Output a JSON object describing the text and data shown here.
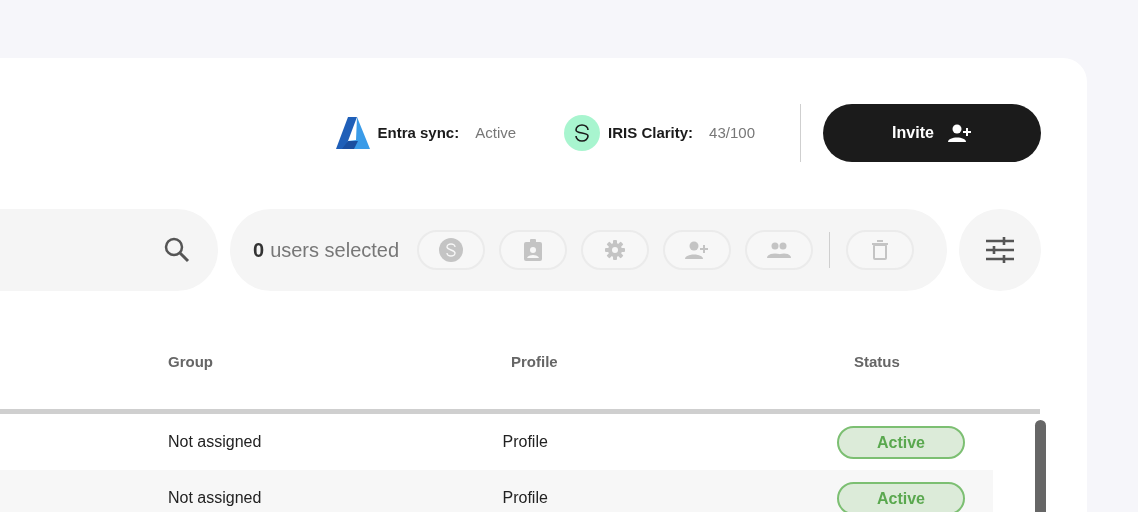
{
  "header": {
    "entra_sync": {
      "label": "Entra sync:",
      "value": "Active"
    },
    "iris_clarity": {
      "label": "IRIS Clarity:",
      "value": "43/100"
    },
    "invite_button": "Invite"
  },
  "selection": {
    "count": "0",
    "text": "users selected",
    "actions": [
      {
        "kind": "clarity"
      },
      {
        "kind": "profile"
      },
      {
        "kind": "settings"
      },
      {
        "kind": "add-user"
      },
      {
        "kind": "group"
      },
      {
        "kind": "delete"
      }
    ]
  },
  "table": {
    "columns": [
      "Group",
      "Profile",
      "Status"
    ],
    "rows": [
      {
        "group": "Not assigned",
        "profile": "Profile",
        "status": "Active"
      },
      {
        "group": "Not assigned",
        "profile": "Profile",
        "status": "Active"
      }
    ]
  }
}
